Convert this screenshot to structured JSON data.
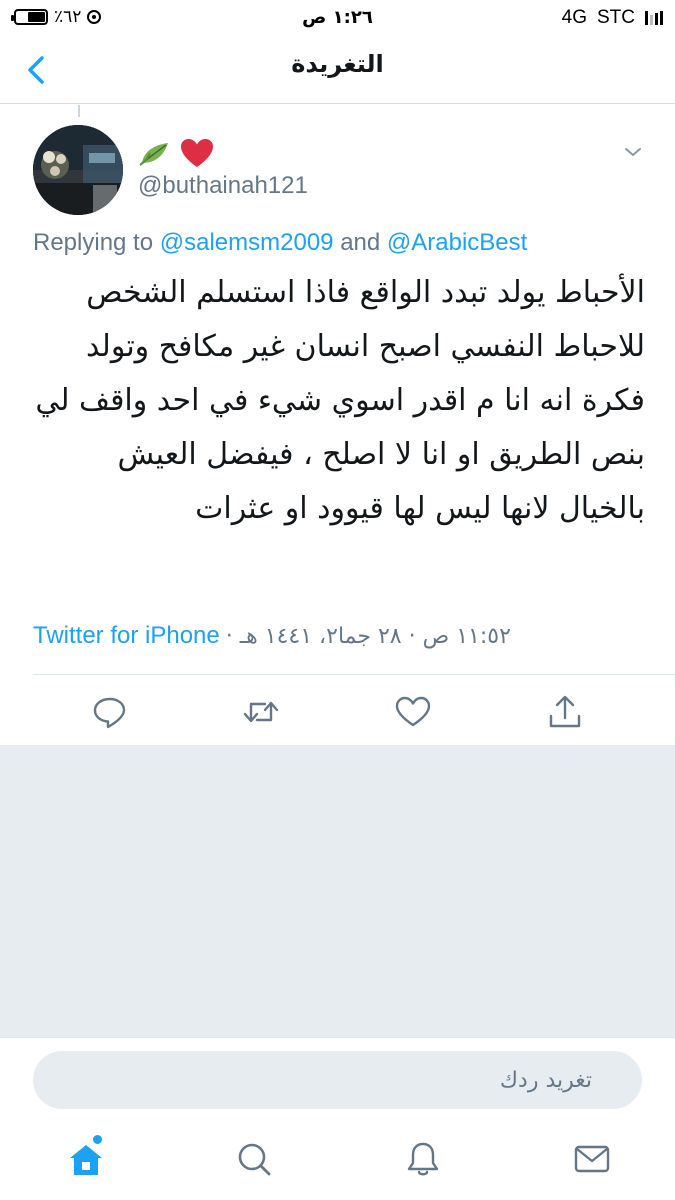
{
  "status_bar": {
    "carrier": "STC",
    "network": "4G",
    "time": "١:٢٦ ص",
    "battery_percent": "٪٦٢",
    "battery_level": 0.62
  },
  "nav": {
    "title": "التغريدة",
    "back_icon": "chevron-left-icon"
  },
  "tweet": {
    "emoji": [
      "leaf-icon",
      "heart-icon"
    ],
    "handle": "@buthainah121",
    "replying_prefix": "Replying to",
    "replying_mention_1": "@salemsm2009",
    "replying_and": "and",
    "replying_mention_2": "@ArabicBest",
    "text": "الأحباط يولد تبدد الواقع فاذا استسلم الشخص للاحباط النفسي اصبح انسان غير مكافح وتولد فكرة انه انا م اقدر اسوي شيء في احد واقف لي بنص الطريق او انا لا اصلح ، فيفضل العيش بالخيال لانها ليس لها قيوود او عثرات",
    "timestamp": "١١:٥٢ ص · ٢٨ جما٢، ١٤٤١ هـ ·",
    "source": "Twitter for iPhone",
    "actions": [
      "reply-icon",
      "retweet-icon",
      "like-icon",
      "share-icon"
    ]
  },
  "reply_bar": {
    "placeholder": "تغريد ردك"
  },
  "tab_bar": {
    "tabs": [
      "home-icon",
      "search-icon",
      "notifications-icon",
      "messages-icon"
    ],
    "active_tab": "home-icon"
  },
  "colors": {
    "accent": "#1da1f2",
    "secondary_text": "#657786",
    "background_gray": "#e6ecf0",
    "heart": "#e0245e"
  }
}
